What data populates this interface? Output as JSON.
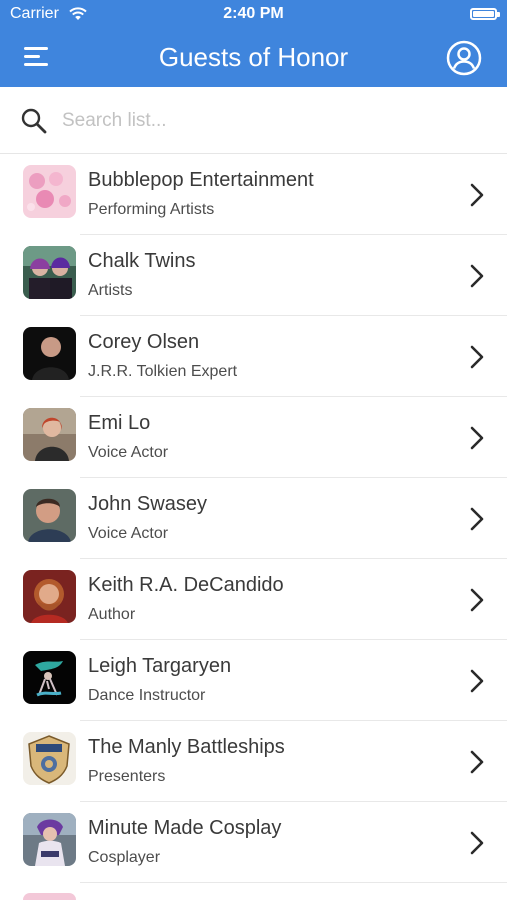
{
  "status_bar": {
    "carrier": "Carrier",
    "time": "2:40 PM"
  },
  "header": {
    "title": "Guests of Honor",
    "menu_icon": "hamburger-menu-icon",
    "profile_icon": "user-circle-icon"
  },
  "search": {
    "placeholder": "Search list...",
    "value": ""
  },
  "guests": [
    {
      "name": "Bubblepop Entertainment",
      "role": "Performing Artists"
    },
    {
      "name": "Chalk Twins",
      "role": "Artists"
    },
    {
      "name": "Corey Olsen",
      "role": "J.R.R. Tolkien Expert"
    },
    {
      "name": "Emi Lo",
      "role": "Voice Actor"
    },
    {
      "name": "John Swasey",
      "role": "Voice Actor"
    },
    {
      "name": "Keith R.A. DeCandido",
      "role": "Author"
    },
    {
      "name": "Leigh Targaryen",
      "role": "Dance Instructor"
    },
    {
      "name": "The Manly Battleships",
      "role": "Presenters"
    },
    {
      "name": "Minute Made Cosplay",
      "role": "Cosplayer"
    }
  ],
  "colors": {
    "header_bg": "#3f85dd",
    "text": "#3a3a3a",
    "divider": "#e8e8e8"
  }
}
